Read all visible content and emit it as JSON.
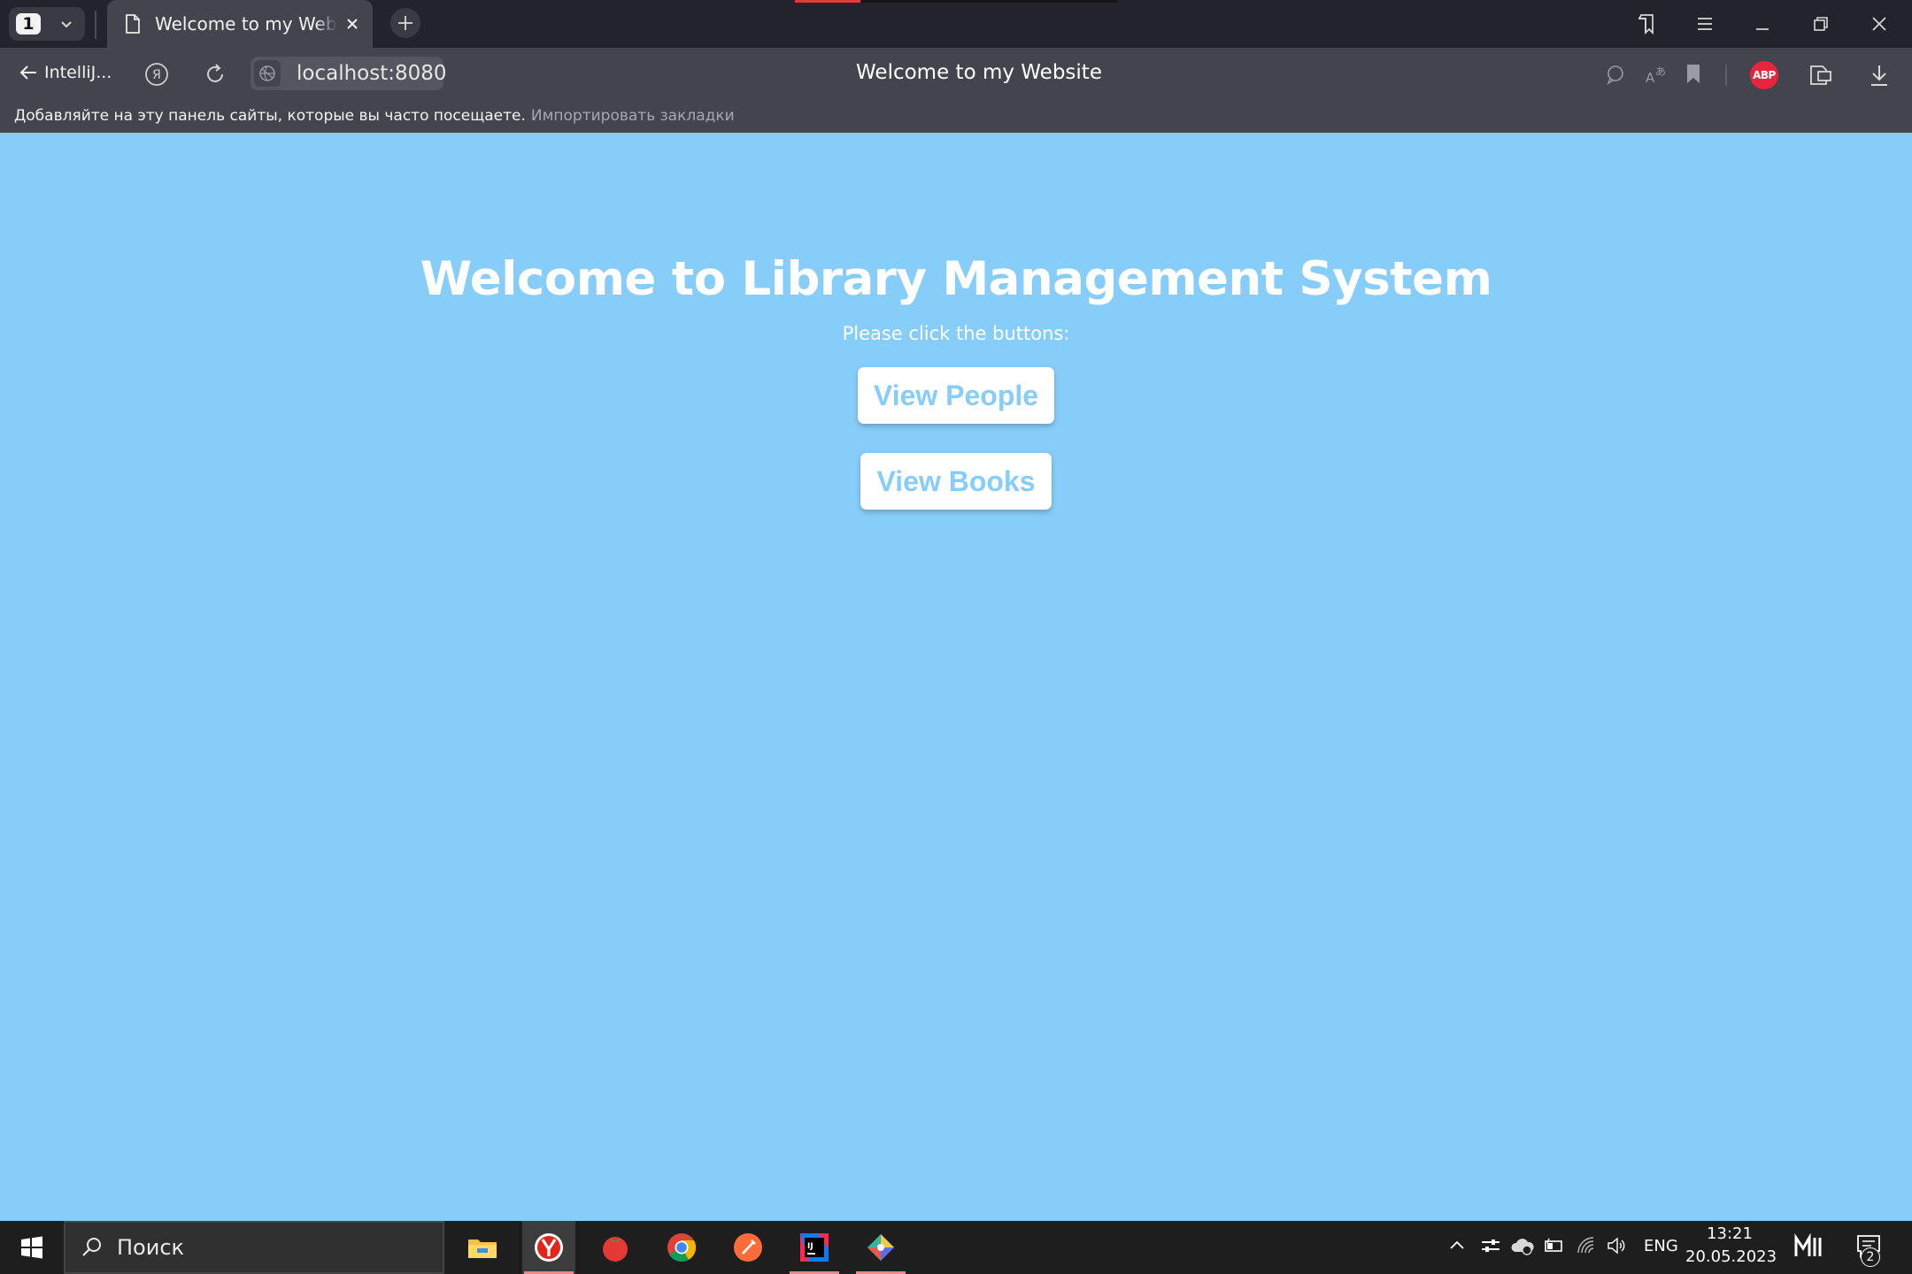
{
  "browser": {
    "tab_count": "1",
    "active_tab_title": "Welcome to my Website",
    "back_label": "IntelliJ...",
    "url": "localhost:8080",
    "page_title": "Welcome to my Website",
    "adblock_label": "ABP",
    "bookmarks_hint": "Добавляйте на эту панель сайты, которые вы часто посещаете.",
    "bookmarks_import": "Импортировать закладки",
    "accent_color": "#e63a3a",
    "tab_icons": [
      "tab-list-chevron-icon",
      "page-icon",
      "close-icon",
      "plus-icon"
    ],
    "window_icons": [
      "bookmarks-collection-icon",
      "menu-icon",
      "minimize-icon",
      "restore-icon",
      "close-icon"
    ],
    "address_icons": [
      "back-arrow-icon",
      "yandex-icon",
      "reload-icon",
      "globe-icon",
      "comment-icon",
      "translate-icon",
      "bookmark-icon",
      "adblock-icon",
      "reading-list-icon",
      "download-icon"
    ]
  },
  "page": {
    "heading": "Welcome to Library Management System",
    "subtitle": "Please click the buttons:",
    "buttons": {
      "people": "View People",
      "books": "View Books"
    },
    "background_color": "#87cdf9",
    "button_text_color": "#87cdf9"
  },
  "taskbar": {
    "search_placeholder": "Поиск",
    "apps": [
      "file-explorer-icon",
      "yandex-browser-icon",
      "tomato-timer-icon",
      "chrome-icon",
      "postman-icon",
      "intellij-icon",
      "git-kraken-icon"
    ],
    "language": "ENG",
    "time": "13:21",
    "date": "20.05.2023",
    "notification_count": "2"
  }
}
